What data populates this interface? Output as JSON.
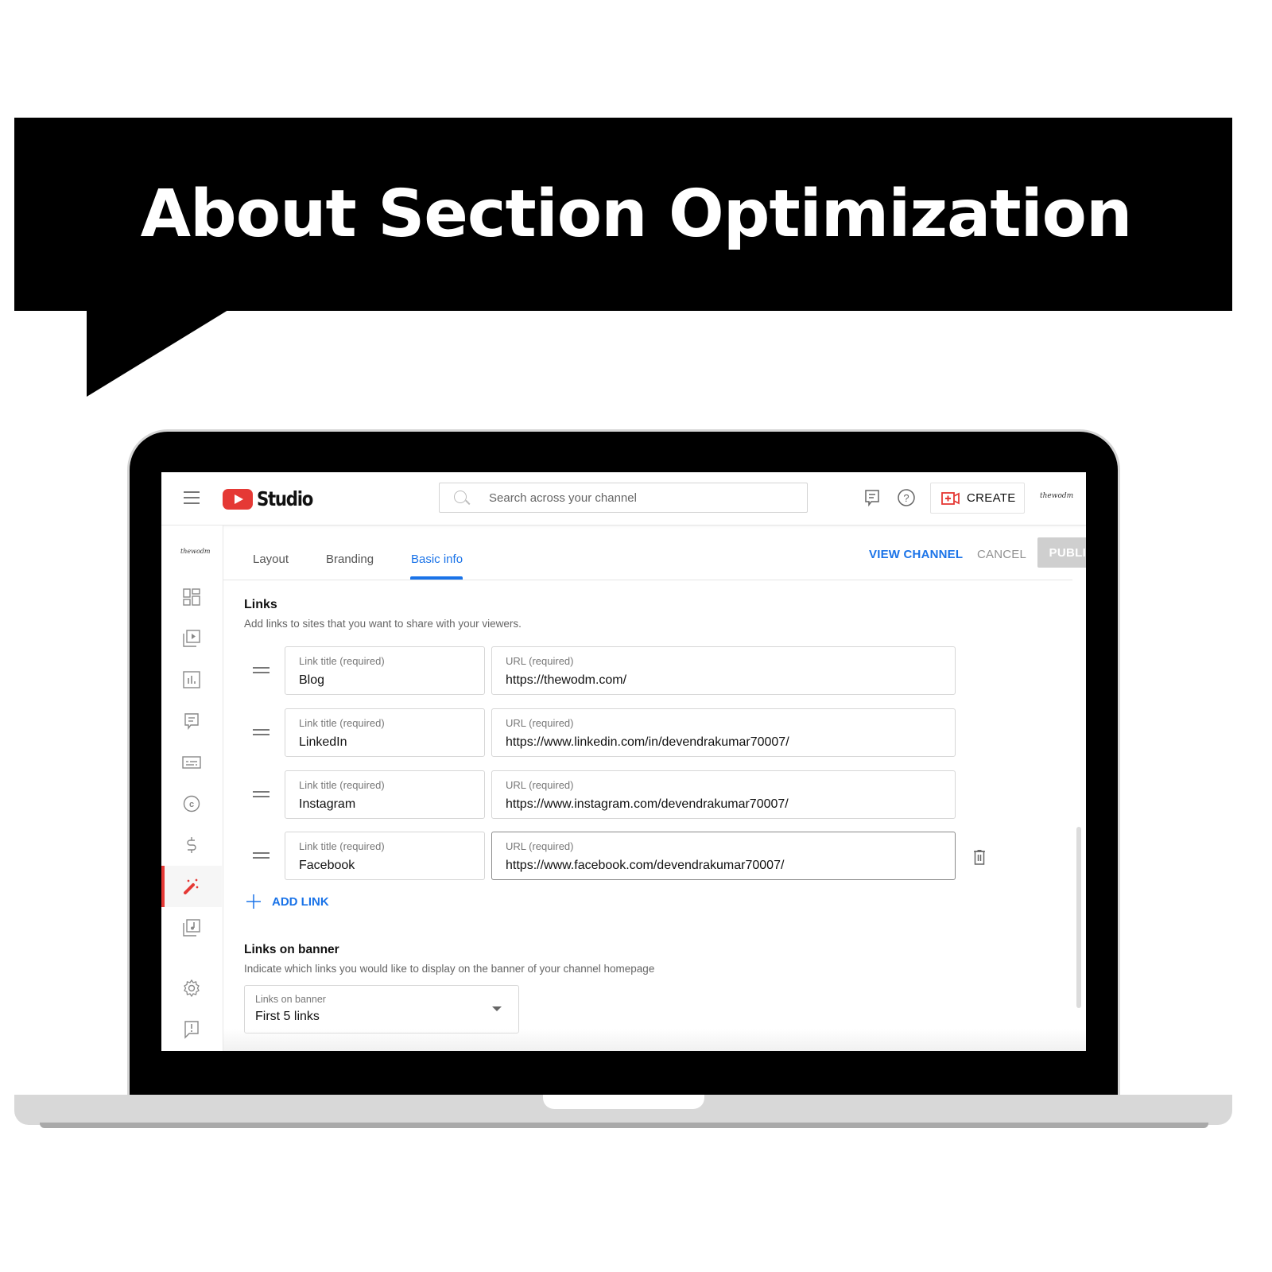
{
  "banner": {
    "title": "About Section Optimization"
  },
  "app": {
    "logo_text": "Studio",
    "search": {
      "placeholder": "Search across your channel",
      "value": ""
    },
    "header_icons": [
      "feedback-icon",
      "help-icon"
    ],
    "create_label": "CREATE",
    "channel_avatar_text": "thewodm"
  },
  "sidebar": {
    "channel_avatar_text": "thewodm",
    "items": [
      {
        "name": "dashboard",
        "icon": "dashboard-icon",
        "active": false
      },
      {
        "name": "content",
        "icon": "content-icon",
        "active": false
      },
      {
        "name": "analytics",
        "icon": "analytics-icon",
        "active": false
      },
      {
        "name": "comments",
        "icon": "comments-icon",
        "active": false
      },
      {
        "name": "subtitles",
        "icon": "subtitles-icon",
        "active": false
      },
      {
        "name": "copyright",
        "icon": "copyright-icon",
        "active": false
      },
      {
        "name": "earn",
        "icon": "dollar-icon",
        "active": false
      },
      {
        "name": "customization",
        "icon": "magic-wand-icon",
        "active": true
      },
      {
        "name": "audio-library",
        "icon": "audio-library-icon",
        "active": false
      },
      {
        "name": "settings",
        "icon": "gear-icon",
        "active": false
      },
      {
        "name": "send-feedback",
        "icon": "feedback-icon",
        "active": false
      }
    ]
  },
  "tabs": [
    {
      "label": "Layout",
      "active": false
    },
    {
      "label": "Branding",
      "active": false
    },
    {
      "label": "Basic info",
      "active": true
    }
  ],
  "actions": {
    "view_channel": "VIEW CHANNEL",
    "cancel": "CANCEL",
    "publish": "PUBLISH"
  },
  "links_section": {
    "title": "Links",
    "description": "Add links to sites that you want to share with your viewers.",
    "title_field_label": "Link title (required)",
    "url_field_label": "URL (required)",
    "links": [
      {
        "title": "Blog",
        "url": "https://thewodm.com/"
      },
      {
        "title": "LinkedIn",
        "url": "https://www.linkedin.com/in/devendrakumar70007/"
      },
      {
        "title": "Instagram",
        "url": "https://www.instagram.com/devendrakumar70007/"
      },
      {
        "title": "Facebook",
        "url": "https://www.facebook.com/devendrakumar70007/"
      }
    ],
    "add_link_label": "ADD LINK"
  },
  "banner_links_section": {
    "title": "Links on banner",
    "description": "Indicate which links you would like to display on the banner of your channel homepage",
    "select_label": "Links on banner",
    "select_value": "First 5 links"
  },
  "colors": {
    "accent": "#1a73e8",
    "brand_red": "#e53935",
    "publish_disabled": "#cfcfcf"
  }
}
